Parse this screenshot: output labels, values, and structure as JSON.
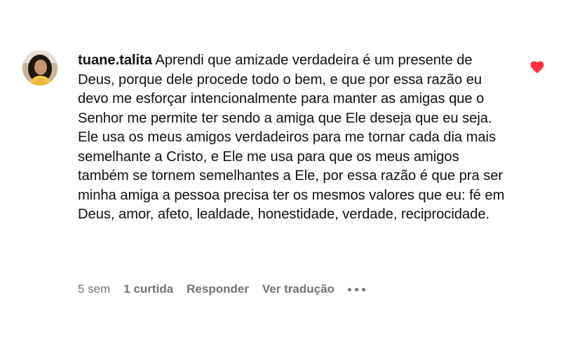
{
  "comment": {
    "username": "tuane.talita",
    "text": "Aprendi que amizade verdadeira é um presente de Deus, porque dele procede todo o bem, e que por essa razão eu devo me esforçar intencionalmente para manter as amigas que o Senhor me permite ter sendo a amiga que Ele deseja que eu seja. Ele usa os meus amigos verdadeiros para me tornar cada dia mais semelhante a Cristo, e Ele me usa para que os meus amigos também se tornem semelhantes a Ele, por essa razão é que pra ser minha amiga a pessoa precisa ter os mesmos valores que eu: fé em Deus, amor, afeto, lealdade, honestidade, verdade, reciprocidade.",
    "time": "5 sem",
    "likes": "1 curtida",
    "reply_label": "Responder",
    "translate_label": "Ver tradução",
    "liked": true
  },
  "colors": {
    "heart": "#ff3040",
    "secondary_text": "#737373",
    "text": "#111111",
    "background": "#ffffff"
  },
  "icons": {
    "like": "heart-icon",
    "more": "more-options-icon"
  }
}
